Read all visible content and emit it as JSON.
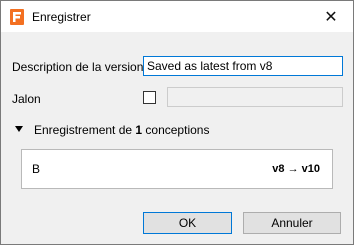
{
  "window": {
    "title": "Enregistrer",
    "close_glyph": "✕",
    "app_icon": "fusion-app-icon",
    "accent_color": "#0078d7"
  },
  "form": {
    "description_label": "Description de la version",
    "description_value": "Saved as latest from v8",
    "milestone_label": "Jalon",
    "milestone_checked": false,
    "milestone_value": ""
  },
  "section": {
    "prefix": "Enregistrement de ",
    "count": "1",
    "suffix": " conceptions"
  },
  "designs": [
    {
      "name": "B",
      "version": "v8 → v10"
    }
  ],
  "buttons": {
    "ok": "OK",
    "cancel": "Annuler"
  }
}
